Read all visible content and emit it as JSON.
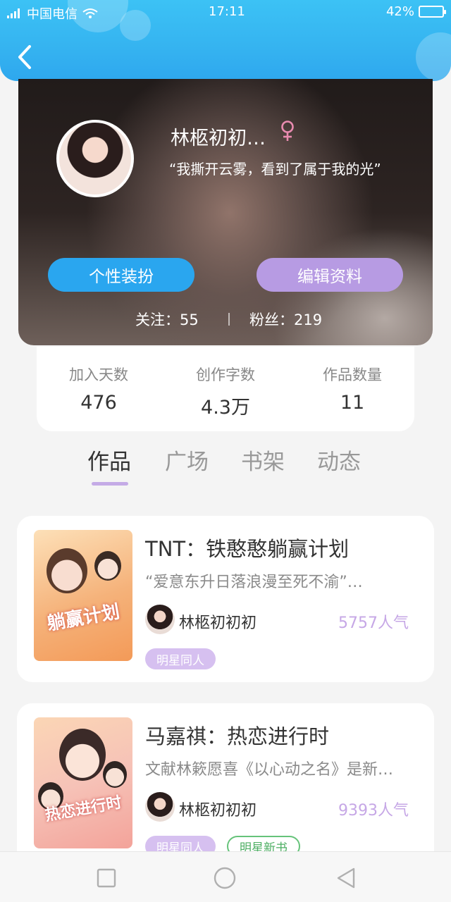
{
  "status_bar": {
    "carrier": "中国电信",
    "time": "17:11",
    "battery": "42%"
  },
  "profile": {
    "username": "林柩初初…",
    "bio": "“我撕开云雾，看到了属于我的光”",
    "buttons": {
      "style": "个性装扮",
      "edit": "编辑资料"
    },
    "following": "关注：55",
    "followers": "粉丝：219"
  },
  "stats": [
    {
      "label": "加入天数",
      "value": "476"
    },
    {
      "label": "创作字数",
      "value": "4.3万"
    },
    {
      "label": "作品数量",
      "value": "11"
    }
  ],
  "tabs": [
    "作品",
    "广场",
    "书架",
    "动态"
  ],
  "works": [
    {
      "title": "TNT：铁憨憨躺赢计划",
      "desc": "“爱意东升日落浪漫至死不渝”…",
      "author": "林柩初初初",
      "popularity": "5757人气",
      "tags": [
        "明星同人"
      ],
      "cover_text": "躺赢计划"
    },
    {
      "title": "马嘉祺：热恋进行时",
      "desc": "文献林簌愿喜《以心动之名》是新…",
      "author": "林柩初初初",
      "popularity": "9393人气",
      "tags": [
        "明星同人",
        "明星新书"
      ],
      "cover_text": "热恋进行时"
    }
  ],
  "colors": {
    "header_blue": "#35b3f0",
    "button_blue": "#2aa6ef",
    "button_purple": "#b79be3",
    "popularity_purple": "#c6a7e6",
    "tag_green": "#66c37a"
  }
}
